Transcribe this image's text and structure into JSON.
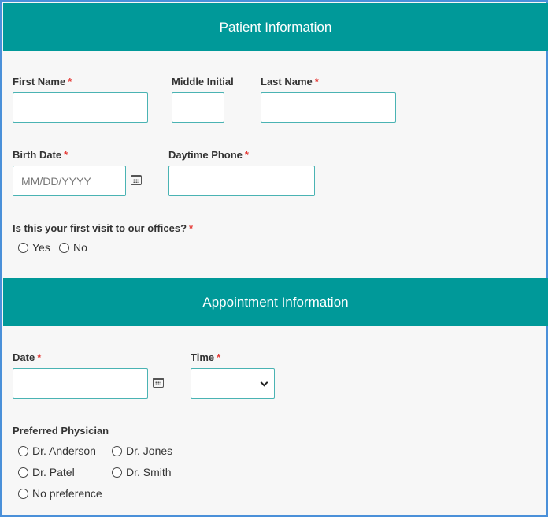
{
  "patient_section": {
    "title": "Patient Information",
    "first_name_label": "First Name",
    "middle_initial_label": "Middle Initial",
    "last_name_label": "Last Name",
    "birth_date_label": "Birth Date",
    "birth_date_placeholder": "MM/DD/YYYY",
    "daytime_phone_label": "Daytime Phone",
    "first_visit_question": "Is this your first visit to our offices?",
    "first_visit_options": [
      "Yes",
      "No"
    ],
    "required_mark": "*"
  },
  "appointment_section": {
    "title": "Appointment Information",
    "date_label": "Date",
    "time_label": "Time",
    "time_selected": "",
    "preferred_physician_label": "Preferred Physician",
    "physician_options": [
      "Dr. Anderson",
      "Dr. Jones",
      "Dr. Patel",
      "Dr. Smith",
      "No preference"
    ]
  },
  "icons": {
    "calendar": "calendar-icon",
    "dropdown": "chevron-down-icon",
    "radio": "radio-icon"
  },
  "colors": {
    "header_bg": "#009999",
    "header_text": "#ffffff",
    "required": "#e53935",
    "input_border": "#4ab3b3",
    "frame_border": "#4a90d9",
    "page_bg": "#f7f7f7"
  }
}
